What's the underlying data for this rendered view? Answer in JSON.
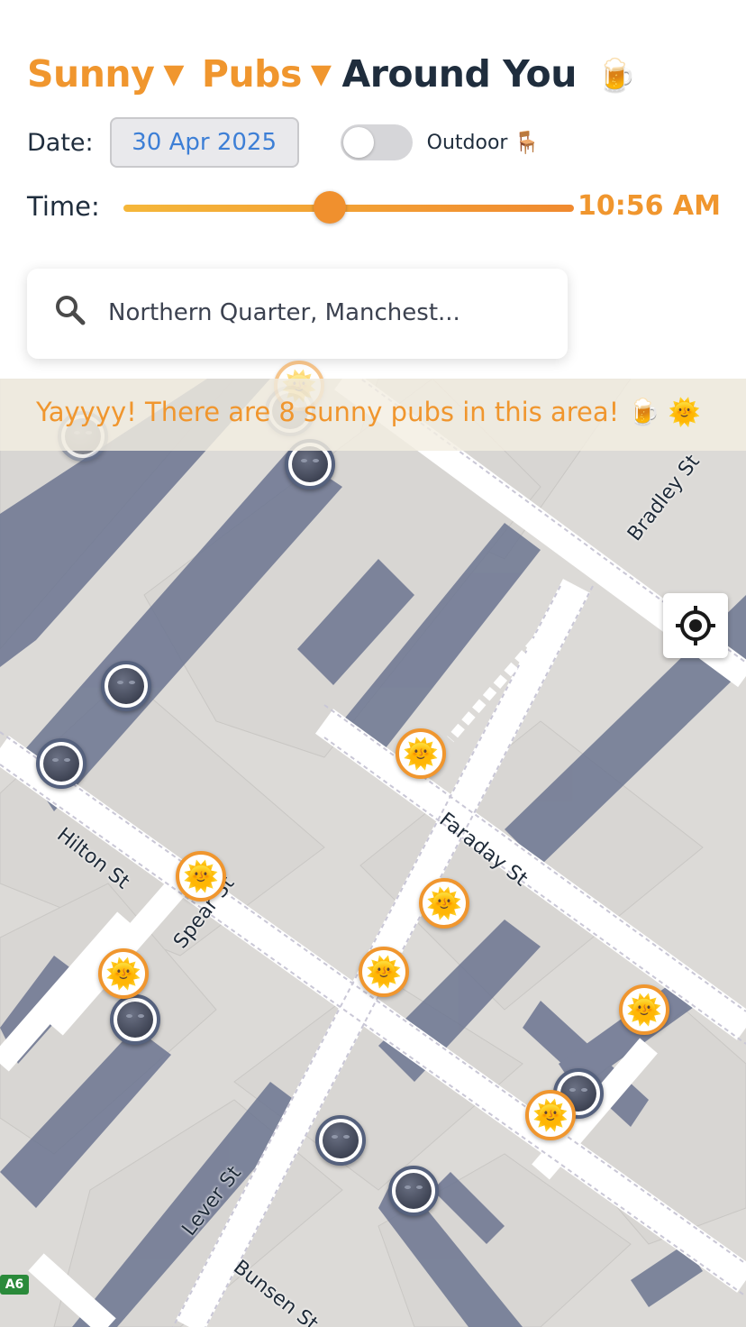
{
  "header": {
    "title_part1": "Sunny",
    "title_part2": "Pubs",
    "title_part3": "Around You",
    "caret": "▼",
    "beer_emoji": "🍺"
  },
  "date": {
    "label": "Date:",
    "value": "30 Apr 2025"
  },
  "outdoor": {
    "label": "Outdoor",
    "emoji": "🪑",
    "enabled": false
  },
  "time": {
    "label": "Time:",
    "value": "10:56 AM"
  },
  "search": {
    "value": "Northern Quarter, Manchest..."
  },
  "banner": {
    "text": "Yayyyy! There are 8 sunny pubs in this area! 🍺 🌞"
  },
  "map": {
    "streets": [
      "Bradley St",
      "Faraday St",
      "Hilton St",
      "Spear St",
      "Lever St",
      "Bunsen St",
      "Lever St"
    ],
    "road_badge": "A6",
    "sun_marker_glyph": "🌞",
    "sunny_count": 8,
    "shaded_count": 8
  },
  "colors": {
    "accent": "#f0962e",
    "title_dark": "#1f2d3d",
    "date_blue": "#3d7fd6",
    "shadow": "#6c7591"
  },
  "icons": [
    "search-icon",
    "locate-me-icon",
    "beer-icon",
    "chair-icon",
    "sun-face-icon",
    "moon-face-icon"
  ]
}
